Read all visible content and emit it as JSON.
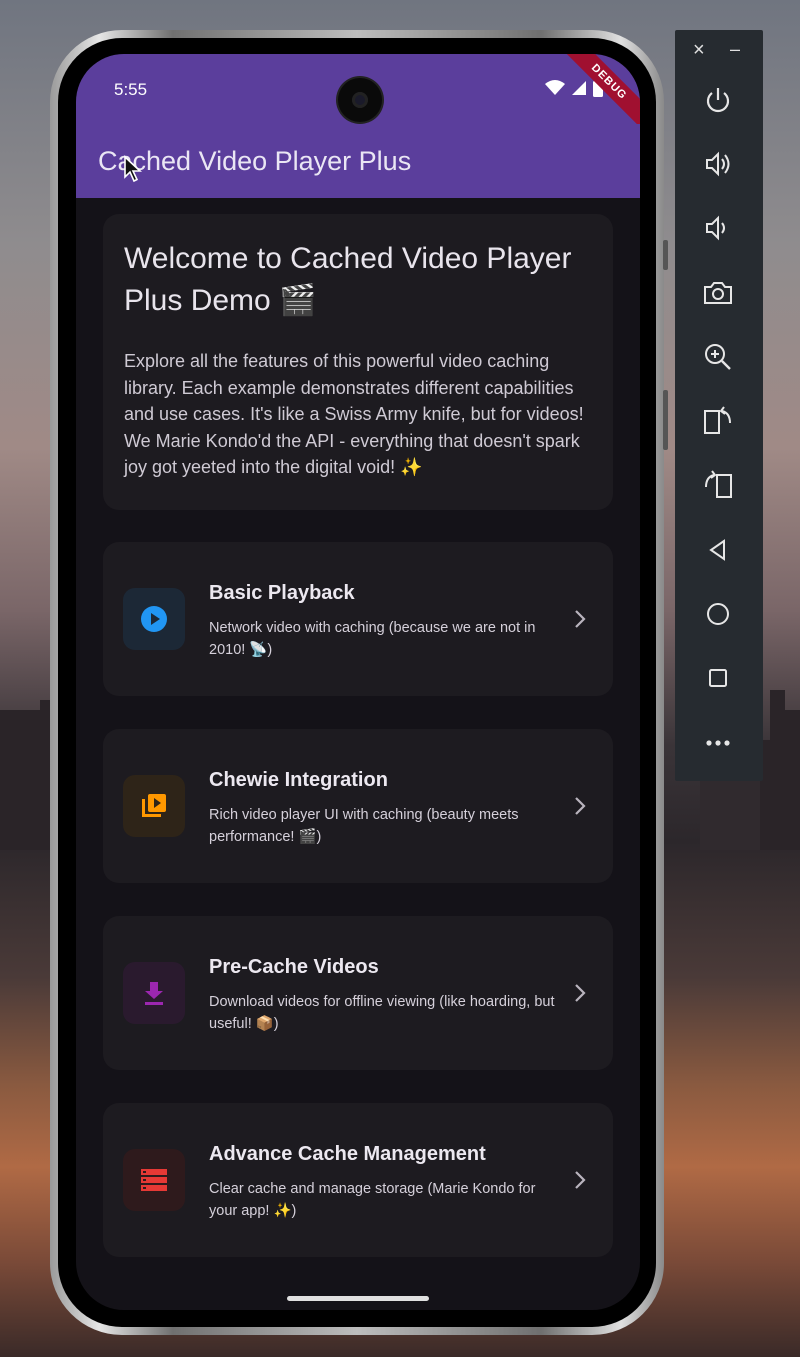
{
  "status_bar": {
    "time": "5:55",
    "debug_banner": "DEBUG"
  },
  "app_bar": {
    "title": "Cached Video Player Plus"
  },
  "welcome": {
    "title": "Welcome to Cached Video Player Plus Demo 🎬",
    "body": "Explore all the features of this powerful video caching library. Each example demonstrates different capabilities and use cases. It's like a Swiss Army knife, but for videos! We Marie Kondo'd the API - everything that doesn't spark joy got yeeted into the digital void! ✨"
  },
  "features": [
    {
      "title": "Basic Playback",
      "description": "Network video with caching (because we are not in 2010! 📡)",
      "icon": "play-circle-icon",
      "accent": "#2196f3"
    },
    {
      "title": "Chewie Integration",
      "description": "Rich video player UI with caching (beauty meets performance! 🎬)",
      "icon": "video-library-icon",
      "accent": "#ff9800"
    },
    {
      "title": "Pre-Cache Videos",
      "description": "Download videos for offline viewing (like hoarding, but useful! 📦)",
      "icon": "download-icon",
      "accent": "#9c27b0"
    },
    {
      "title": "Advance Cache Management",
      "description": "Clear cache and manage storage (Marie Kondo for your app! ✨)",
      "icon": "storage-icon",
      "accent": "#e53935"
    }
  ],
  "emulator_toolbar": {
    "close_label": "×",
    "minimize_label": "–",
    "items": [
      "power-icon",
      "volume-up-icon",
      "volume-down-icon",
      "camera-icon",
      "zoom-icon",
      "rotate-left-icon",
      "rotate-right-icon",
      "back-icon",
      "home-icon",
      "overview-icon",
      "more-icon"
    ]
  },
  "colors": {
    "app_bar": "#5b3e9c",
    "background": "#141218",
    "card": "#1d1b20"
  }
}
